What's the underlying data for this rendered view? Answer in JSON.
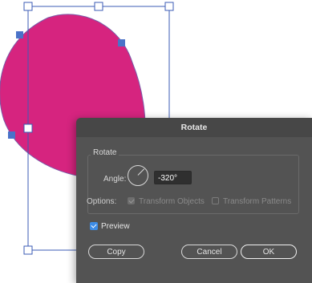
{
  "canvas": {
    "shape_fill": "#d6247f",
    "selection_color": "#3b5bb5"
  },
  "dialog": {
    "title": "Rotate",
    "group_label": "Rotate",
    "angle_label": "Angle:",
    "angle_value": "-320°",
    "options_label": "Options:",
    "transform_objects_label": "Transform Objects",
    "transform_patterns_label": "Transform Patterns",
    "transform_objects_checked": true,
    "transform_patterns_checked": false,
    "preview_label": "Preview",
    "preview_checked": true,
    "copy_button": "Copy",
    "cancel_button": "Cancel",
    "ok_button": "OK"
  }
}
